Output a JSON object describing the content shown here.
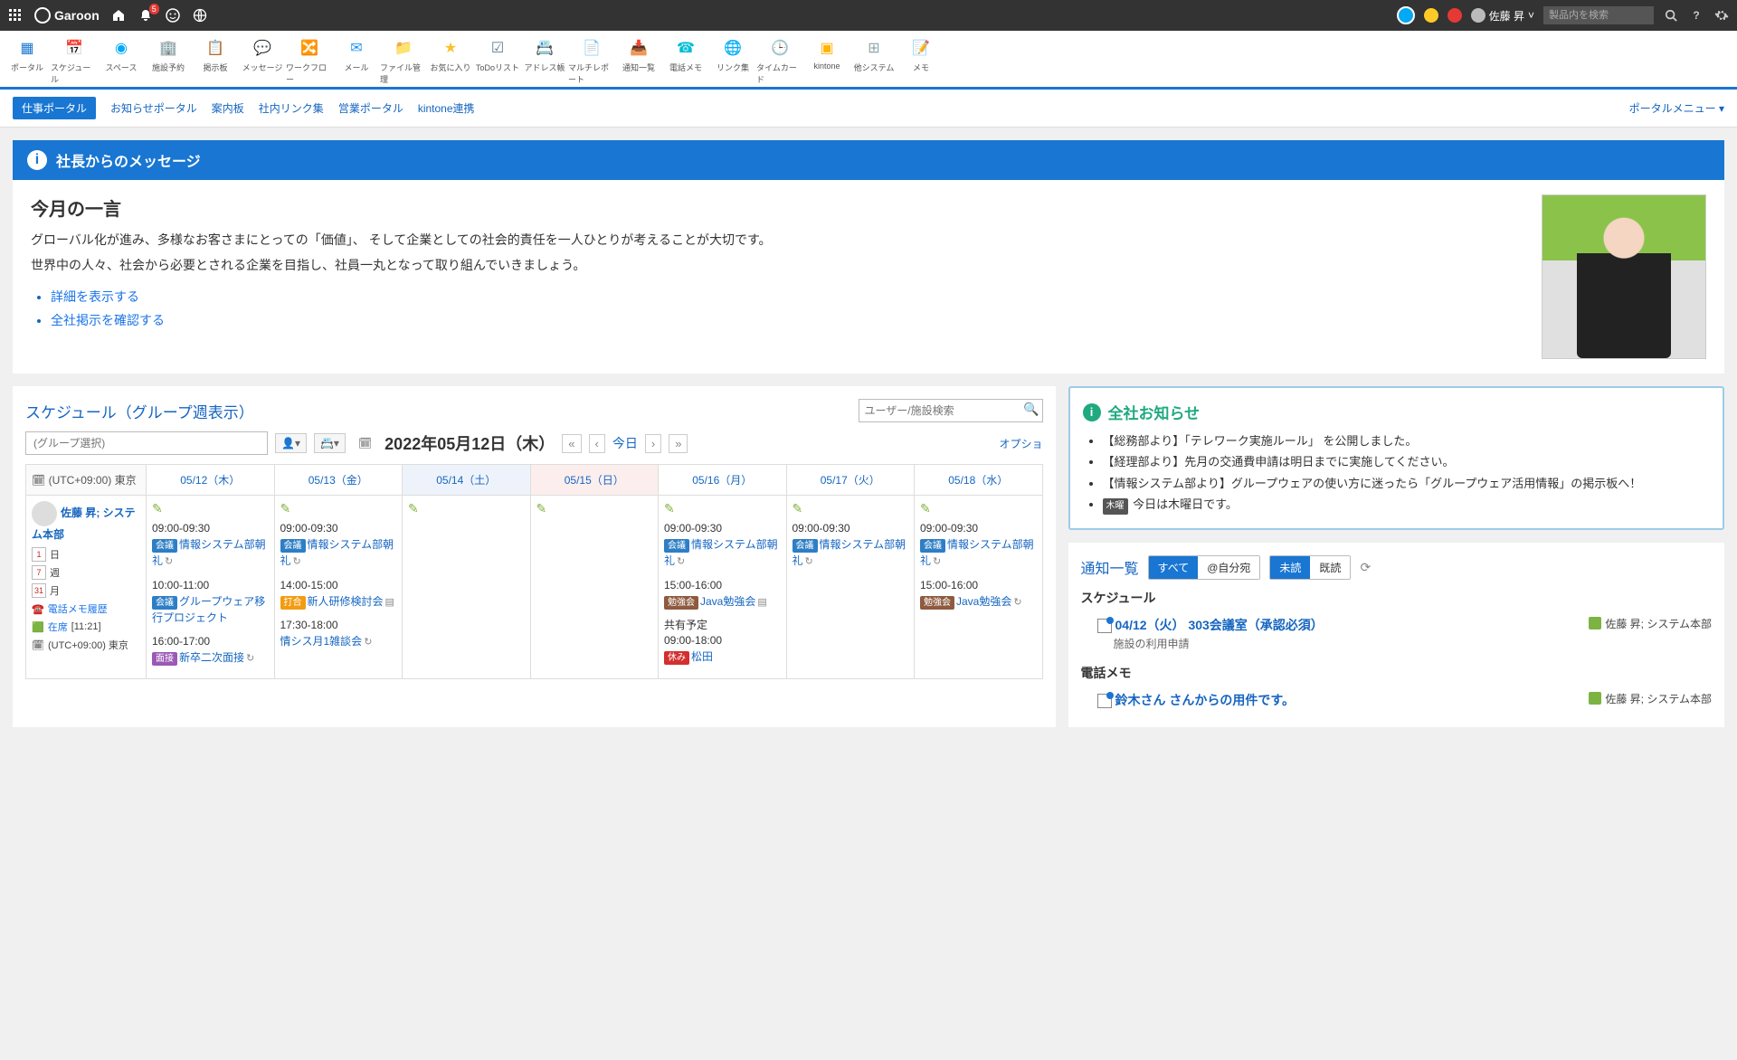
{
  "topbar": {
    "brand": "Garoon",
    "notif_count": "5",
    "username": "佐藤 昇",
    "search_placeholder": "製品内を検索"
  },
  "apps": [
    {
      "label": "ポータル"
    },
    {
      "label": "スケジュール"
    },
    {
      "label": "スペース"
    },
    {
      "label": "施設予約"
    },
    {
      "label": "掲示板"
    },
    {
      "label": "メッセージ"
    },
    {
      "label": "ワークフロー"
    },
    {
      "label": "メール"
    },
    {
      "label": "ファイル管理"
    },
    {
      "label": "お気に入り"
    },
    {
      "label": "ToDoリスト"
    },
    {
      "label": "アドレス帳"
    },
    {
      "label": "マルチレポート"
    },
    {
      "label": "通知一覧"
    },
    {
      "label": "電話メモ"
    },
    {
      "label": "リンク集"
    },
    {
      "label": "タイムカード"
    },
    {
      "label": "kintone"
    },
    {
      "label": "他システム"
    },
    {
      "label": "メモ"
    }
  ],
  "portal_tabs": [
    "仕事ポータル",
    "お知らせポータル",
    "案内板",
    "社内リンク集",
    "営業ポータル",
    "kintone連携"
  ],
  "portal_menu": "ポータルメニュー ▾",
  "president": {
    "banner": "社長からのメッセージ",
    "heading": "今月の一言",
    "body1": "グローバル化が進み、多様なお客さまにとっての「価値」、 そして企業としての社会的責任を一人ひとりが考えることが大切です。",
    "body2": "世界中の人々、社会から必要とされる企業を目指し、社員一丸となって取り組んでいきましょう。",
    "links": [
      "詳細を表示する",
      "全社掲示を確認する"
    ]
  },
  "schedule": {
    "title": "スケジュール（グループ週表示）",
    "search_placeholder": "ユーザー/施設検索",
    "group_placeholder": "(グループ選択)",
    "date_label": "2022年05月12日（木）",
    "today": "今日",
    "option": "オプショ",
    "tz_header": "(UTC+09:00) 東京",
    "days": [
      "05/12（木）",
      "05/13（金）",
      "05/14（土）",
      "05/15（日）",
      "05/16（月）",
      "05/17（火）",
      "05/18（水）"
    ],
    "user": {
      "name": "佐藤 昇; システム本部",
      "opts": {
        "day": "日",
        "week": "週",
        "month": "月",
        "phone": "電話メモ履歴",
        "zaiseki_label": "在席",
        "zaiseki_time": "[11:21]",
        "tz": "(UTC+09:00) 東京",
        "day_n": "1",
        "week_n": "7",
        "month_n": "31"
      }
    },
    "cells": [
      [
        {
          "time": "09:00-09:30",
          "tag": "会議",
          "tagcls": "kaigi",
          "title": "情報システム部朝礼",
          "repeat": true
        },
        {
          "time": "10:00-11:00",
          "tag": "会議",
          "tagcls": "kaigi",
          "title": "グループウェア移行プロジェクト"
        },
        {
          "time": "16:00-17:00",
          "tag": "面接",
          "tagcls": "mensetsu",
          "title": "新卒二次面接",
          "repeat": true
        }
      ],
      [
        {
          "time": "09:00-09:30",
          "tag": "会議",
          "tagcls": "kaigi",
          "title": "情報システム部朝礼",
          "repeat": true
        },
        {
          "time": "14:00-15:00",
          "tag": "打合",
          "tagcls": "uchia",
          "title": "新人研修検討会",
          "note": true
        },
        {
          "time": "17:30-18:00",
          "tag": "",
          "tagcls": "",
          "title": "情シス月1雑談会",
          "repeat": true
        }
      ],
      [],
      [],
      [
        {
          "time": "09:00-09:30",
          "tag": "会議",
          "tagcls": "kaigi",
          "title": "情報システム部朝礼",
          "repeat": true
        },
        {
          "time": "15:00-16:00",
          "tag": "勉強会",
          "tagcls": "benkyo",
          "title": "Java勉強会",
          "note": true
        }
      ],
      [
        {
          "time": "09:00-09:30",
          "tag": "会議",
          "tagcls": "kaigi",
          "title": "情報システム部朝礼",
          "repeat": true
        }
      ],
      [
        {
          "time": "09:00-09:30",
          "tag": "会議",
          "tagcls": "kaigi",
          "title": "情報システム部朝礼",
          "repeat": true
        },
        {
          "time": "15:00-16:00",
          "tag": "勉強会",
          "tagcls": "benkyo",
          "title": "Java勉強会",
          "repeat": true
        }
      ]
    ],
    "shared": {
      "header": "共有予定",
      "time": "09:00-18:00",
      "tag": "休み",
      "title": "松田",
      "col": 4
    }
  },
  "announce": {
    "title": "全社お知らせ",
    "items": [
      "【総務部より】「テレワーク実施ルール」 を公開しました。",
      "【経理部より】先月の交通費申請は明日までに実施してください。",
      "【情報システム部より】グループウェアの使い方に迷ったら「グループウェア活用情報」の掲示板へ！"
    ],
    "today_tag": "木曜",
    "today_text": "今日は木曜日です。"
  },
  "notifications": {
    "title": "通知一覧",
    "seg_all": "すべて",
    "seg_mine": "@自分宛",
    "seg_unread": "未読",
    "seg_read": "既読",
    "groups": [
      {
        "name": "スケジュール",
        "items": [
          {
            "title": "04/12（火） 303会議室（承認必須）",
            "sub": "施設の利用申請",
            "who": "佐藤 昇; システム本部"
          }
        ]
      },
      {
        "name": "電話メモ",
        "items": [
          {
            "title": "鈴木さん さんからの用件です。",
            "sub": "",
            "who": "佐藤 昇; システム本部"
          }
        ]
      }
    ]
  }
}
